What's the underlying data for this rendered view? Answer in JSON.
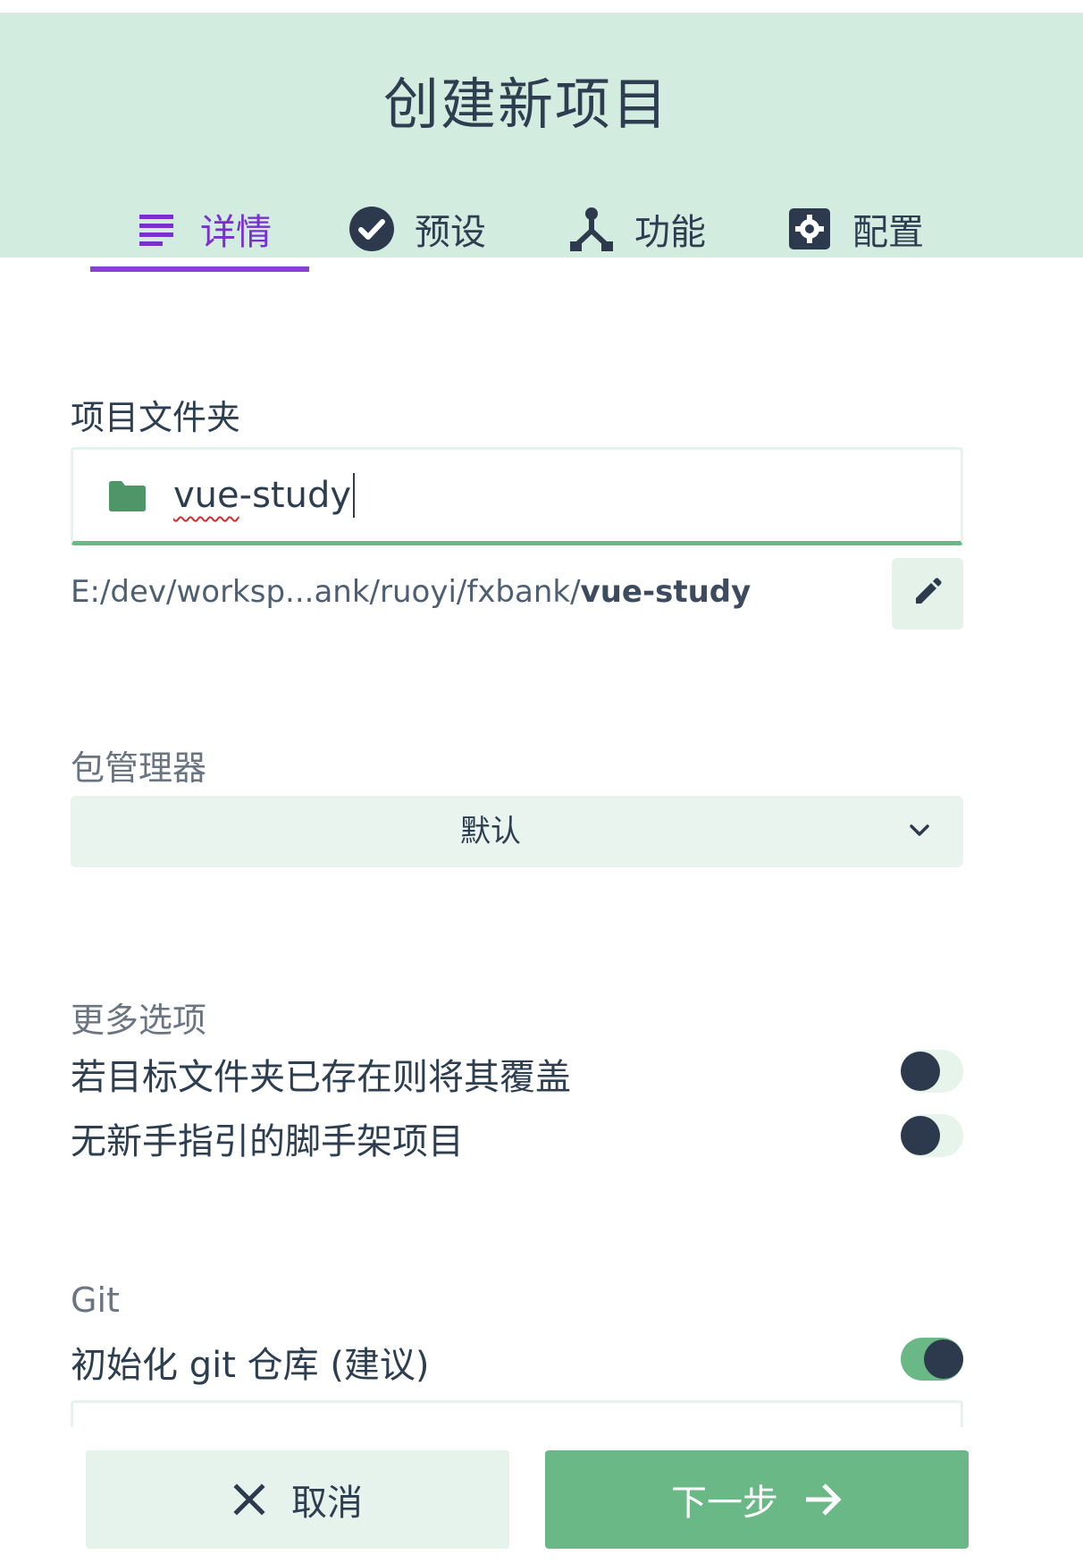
{
  "header": {
    "title": "创建新项目",
    "tabs": [
      {
        "label": "详情",
        "icon": "list-icon",
        "active": true
      },
      {
        "label": "预设",
        "icon": "check-circle-icon",
        "active": false
      },
      {
        "label": "功能",
        "icon": "fork-icon",
        "active": false
      },
      {
        "label": "配置",
        "icon": "settings-icon",
        "active": false
      }
    ]
  },
  "folder": {
    "label": "项目文件夹",
    "value_part1": "vue",
    "value_part2": "-study",
    "path_prefix": "E:/dev/worksp...ank/ruoyi/fxbank/",
    "path_bold": "vue-study"
  },
  "package_manager": {
    "label": "包管理器",
    "selected": "默认"
  },
  "more_options": {
    "label": "更多选项",
    "items": [
      {
        "label": "若目标文件夹已存在则将其覆盖",
        "enabled": false
      },
      {
        "label": "无新手指引的脚手架项目",
        "enabled": false
      }
    ]
  },
  "git": {
    "label": "Git",
    "init_label": "初始化 git 仓库 (建议)",
    "enabled": true
  },
  "footer": {
    "cancel_label": "取消",
    "next_label": "下一步"
  },
  "colors": {
    "header_bg": "#d2ece0",
    "accent_purple": "#8a3fd8",
    "accent_green": "#6ab886",
    "dark": "#2c3e50"
  }
}
